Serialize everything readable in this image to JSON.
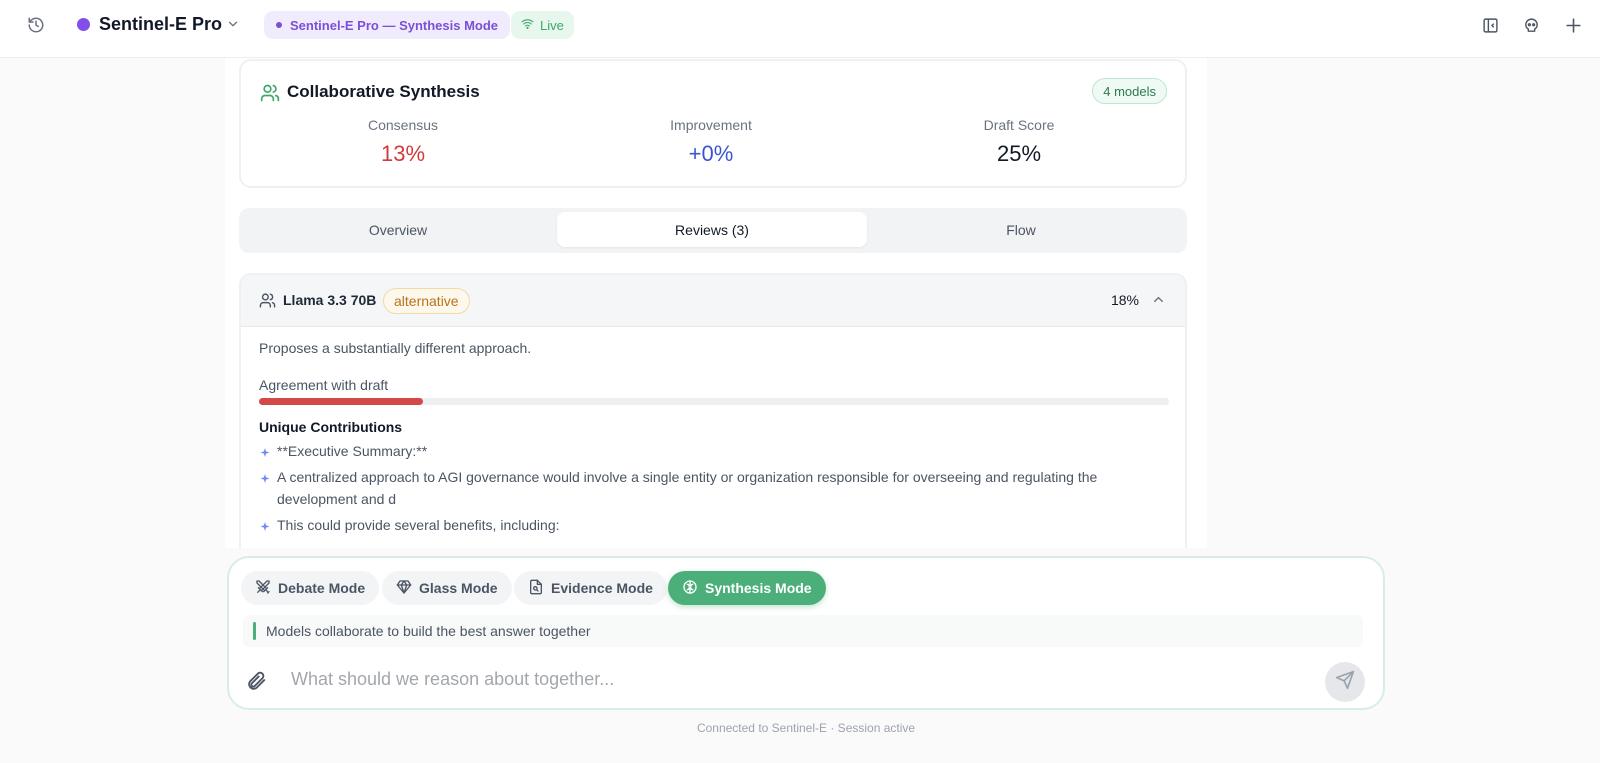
{
  "header": {
    "app_title": "Sentinel-E Pro",
    "mode_pill": "Sentinel-E Pro — Synthesis Mode",
    "live_label": "Live",
    "accent": "#8250e8"
  },
  "synthesis_card": {
    "title": "Collaborative Synthesis",
    "badge": "4 models",
    "metrics": [
      {
        "label": "Consensus",
        "value": "13%",
        "color": "#d23b3b"
      },
      {
        "label": "Improvement",
        "value": "+0%",
        "color": "#3b55d2"
      },
      {
        "label": "Draft Score",
        "value": "25%",
        "color": "#111827"
      }
    ]
  },
  "tabs": [
    {
      "label": "Overview",
      "active": false
    },
    {
      "label": "Reviews (3)",
      "active": true
    },
    {
      "label": "Flow",
      "active": false
    }
  ],
  "review": {
    "model": "Llama 3.3 70B",
    "tag": "alternative",
    "score": "18%",
    "description": "Proposes a substantially different approach.",
    "agreement_label": "Agreement with draft",
    "agreement_fraction": 0.18,
    "unique_title": "Unique Contributions",
    "contributions": [
      "**Executive Summary:**",
      "A centralized approach to AGI governance would involve a single entity or organization responsible for overseeing and regulating the development and d",
      "This could provide several benefits, including:"
    ]
  },
  "composer": {
    "modes": [
      {
        "label": "Debate Mode",
        "icon": "swords-icon",
        "active": false
      },
      {
        "label": "Glass Mode",
        "icon": "diamond-icon",
        "active": false
      },
      {
        "label": "Evidence Mode",
        "icon": "document-search-icon",
        "active": false
      },
      {
        "label": "Synthesis Mode",
        "icon": "brain-icon",
        "active": true
      }
    ],
    "hint": "Models collaborate to build the best answer together",
    "placeholder": "What should we reason about together...",
    "accent": "#4caf79"
  },
  "footer": "Connected to Sentinel-E · Session active"
}
